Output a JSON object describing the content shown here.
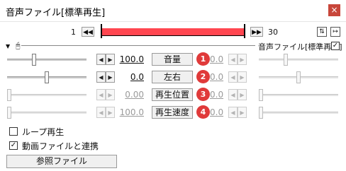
{
  "window": {
    "title": "音声ファイル[標準再生]",
    "close_symbol": "×"
  },
  "frame": {
    "start": "1",
    "end": "30",
    "prev_symbol": "◀◀",
    "next_symbol": "▶▶",
    "position_fraction": 1.0
  },
  "object_label": "音声ファイル[標準再生]",
  "params": [
    {
      "label": "音量",
      "left_value": "100.0",
      "right_value": "0.0",
      "badge": "1",
      "enabled": true,
      "slider_fraction": 0.33
    },
    {
      "label": "左右",
      "left_value": "0.0",
      "right_value": "0.0",
      "badge": "2",
      "enabled": true,
      "slider_fraction": 0.5
    },
    {
      "label": "再生位置",
      "left_value": "0.00",
      "right_value": "0.0",
      "badge": "3",
      "enabled": false,
      "slider_fraction": 0.0
    },
    {
      "label": "再生速度",
      "left_value": "100.0",
      "right_value": "0.0",
      "badge": "4",
      "enabled": false,
      "slider_fraction": 0.0
    }
  ],
  "options": {
    "loop_label": "ループ再生",
    "loop_checked": false,
    "link_label": "動画ファイルと連携",
    "link_checked": true
  },
  "reference_button": "参照ファイル",
  "colors": {
    "timeline_fill": "#ff4650",
    "badge": "#e03a3a",
    "close": "#c8463a"
  }
}
